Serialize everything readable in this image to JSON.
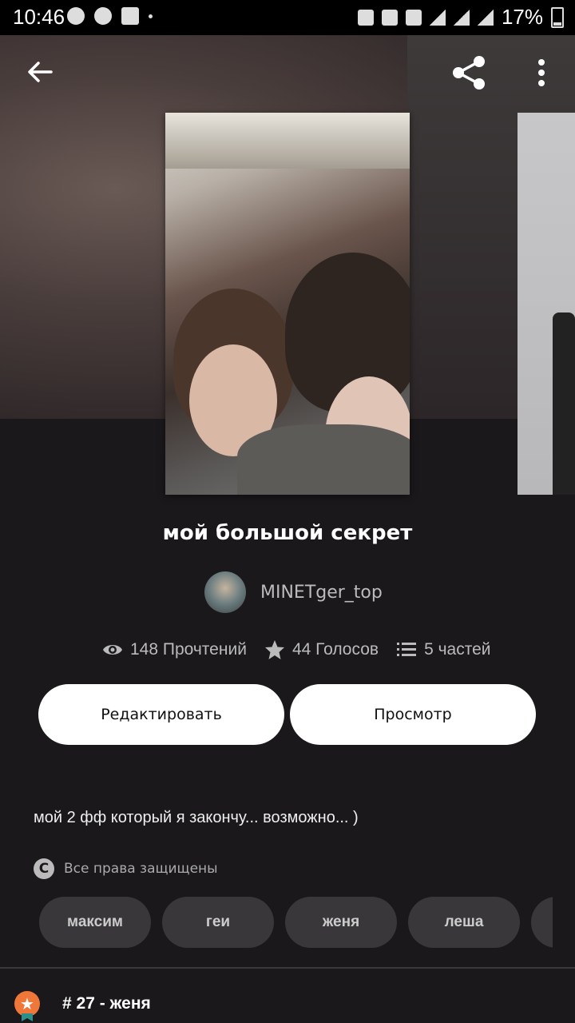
{
  "status_bar": {
    "time": "10:46",
    "battery": "17%"
  },
  "story": {
    "title": "мой большой секрет",
    "author": "MINETger_top",
    "reads": "148 Прочтений",
    "votes": "44 Голосов",
    "parts": "5 частей",
    "description": "мой 2 фф который я закончу... возможно... )",
    "rights": "Все права защищены",
    "copyright_glyph": "C",
    "rank": "# 27 - женя",
    "rank_glyph": "★"
  },
  "actions": {
    "edit_label": "Редактировать",
    "view_label": "Просмотр"
  },
  "tags": [
    "максим",
    "геи",
    "женя",
    "леша"
  ],
  "colors": {
    "background": "#1a181b",
    "button": "#ffffff",
    "tag_bg": "#39373a",
    "rank_badge": "#f0773a"
  },
  "icons": {
    "back": "arrow-left-icon",
    "share": "share-icon",
    "more": "more-vertical-icon",
    "reads": "eye-icon",
    "votes": "star-icon",
    "parts": "list-icon",
    "rights": "copyright-icon",
    "rank": "rank-badge-icon"
  }
}
